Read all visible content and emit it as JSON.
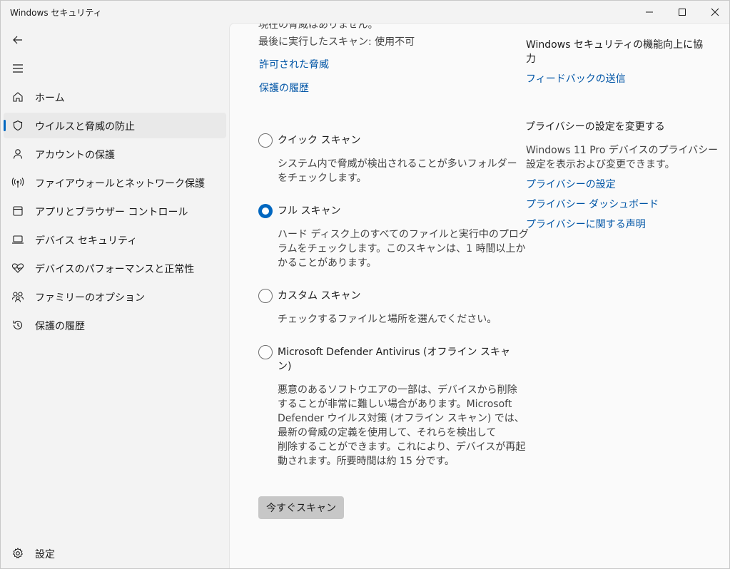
{
  "window": {
    "title": "Windows セキュリティ",
    "minimize_icon": "minimize-icon",
    "maximize_icon": "maximize-icon",
    "close_icon": "close-icon"
  },
  "sidebar": {
    "back_icon": "back-arrow-icon",
    "menu_icon": "hamburger-menu-icon",
    "items": [
      {
        "label": "ホーム",
        "icon": "home-icon"
      },
      {
        "label": "ウイルスと脅威の防止",
        "icon": "shield-icon",
        "selected": true
      },
      {
        "label": "アカウントの保護",
        "icon": "person-icon"
      },
      {
        "label": "ファイアウォールとネットワーク保護",
        "icon": "wifi-antenna-icon"
      },
      {
        "label": "アプリとブラウザー コントロール",
        "icon": "app-window-icon"
      },
      {
        "label": "デバイス セキュリティ",
        "icon": "laptop-icon"
      },
      {
        "label": "デバイスのパフォーマンスと正常性",
        "icon": "heart-pulse-icon"
      },
      {
        "label": "ファミリーのオプション",
        "icon": "family-icon"
      },
      {
        "label": "保護の履歴",
        "icon": "history-icon"
      }
    ],
    "settings": {
      "label": "設定",
      "icon": "gear-icon"
    }
  },
  "main": {
    "cut_text": "現在の脅威はありません。",
    "last_scan": "最後に実行したスキャン: 使用不可",
    "links": {
      "allowed_threats": "許可された脅威",
      "protection_history": "保護の履歴"
    },
    "scan_options": [
      {
        "label": "クイック スキャン",
        "checked": false,
        "desc_lines": [
          "システム内で脅威が検出されることが多いフォルダー",
          "をチェックします。"
        ]
      },
      {
        "label": "フル スキャン",
        "checked": true,
        "desc_lines": [
          "ハード ディスク上のすべてのファイルと実行中のプログ",
          "ラムをチェックします。このスキャンは、1 時間以上か",
          "かることがあります。"
        ]
      },
      {
        "label": "カスタム スキャン",
        "checked": false,
        "desc_lines": [
          "チェックするファイルと場所を選んでください。"
        ]
      },
      {
        "label_lines": [
          "Microsoft Defender Antivirus (オフライン スキャ",
          "ン)"
        ],
        "checked": false,
        "desc_lines": [
          "悪意のあるソフトウエアの一部は、デバイスから削除",
          "することが非常に難しい場合があります。Microsoft",
          "Defender ウイルス対策 (オフライン スキャン) では、",
          "最新の脅威の定義を使用して、それらを検出して",
          "削除することができます。これにより、デバイスが再起",
          "動されます。所要時間は約 15 分です。"
        ]
      }
    ],
    "scan_now_button": "今すぐスキャン"
  },
  "right": {
    "improve_heading_lines": [
      "Windows セキュリティの機能向上に協",
      "力"
    ],
    "feedback_link": "フィードバックの送信",
    "privacy_heading": "プライバシーの設定を変更する",
    "privacy_desc_lines": [
      "Windows 11 Pro デバイスのプライバシー",
      "設定を表示および変更できます。"
    ],
    "privacy_links": [
      "プライバシーの設定",
      "プライバシー ダッシュボード",
      "プライバシーに関する声明"
    ]
  },
  "colors": {
    "accent": "#0067c0",
    "link": "#0055a6",
    "button_disabled_bg": "#c7c7c7"
  }
}
